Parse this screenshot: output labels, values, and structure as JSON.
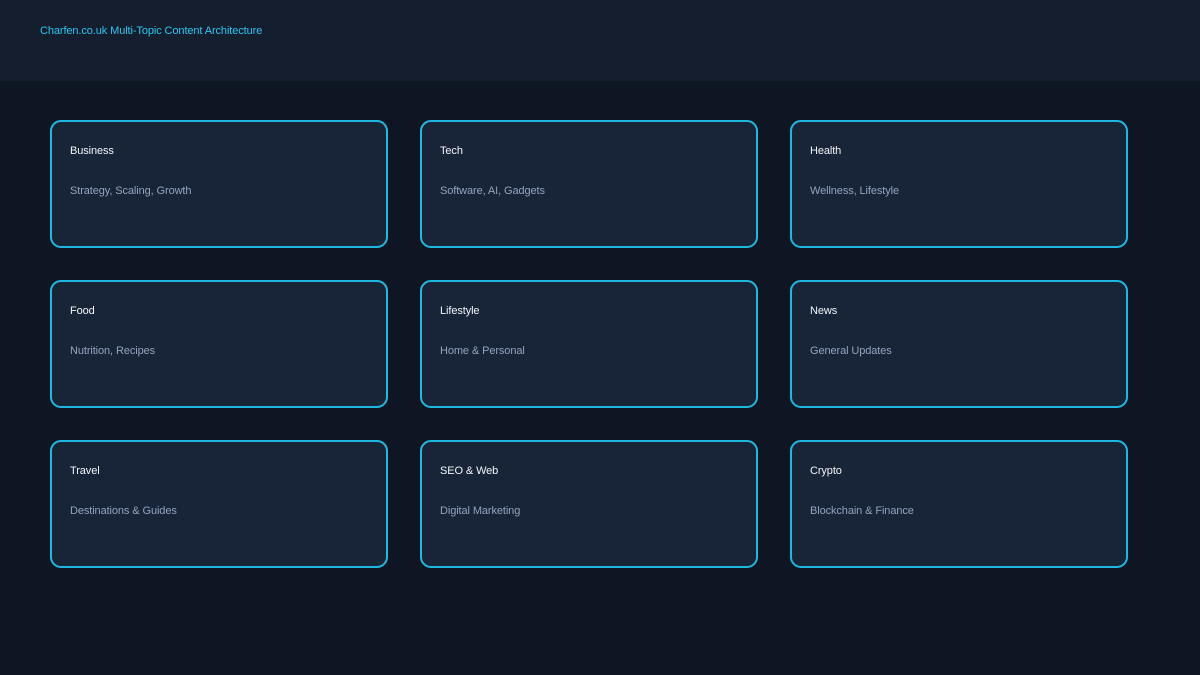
{
  "header": {
    "title": "Charfen.co.uk Multi-Topic Content Architecture"
  },
  "cards": [
    {
      "title": "Business",
      "subtitle": "Strategy, Scaling, Growth"
    },
    {
      "title": "Tech",
      "subtitle": "Software, AI, Gadgets"
    },
    {
      "title": "Health",
      "subtitle": "Wellness, Lifestyle"
    },
    {
      "title": "Food",
      "subtitle": "Nutrition, Recipes"
    },
    {
      "title": "Lifestyle",
      "subtitle": "Home & Personal"
    },
    {
      "title": "News",
      "subtitle": "General Updates"
    },
    {
      "title": "Travel",
      "subtitle": "Destinations & Guides"
    },
    {
      "title": "SEO & Web",
      "subtitle": "Digital Marketing"
    },
    {
      "title": "Crypto",
      "subtitle": "Blockchain & Finance"
    }
  ],
  "colors": {
    "background": "#0f1623",
    "header_background": "#141e2f",
    "card_background": "#182437",
    "card_border": "#1fb8e0",
    "accent": "#2ec6ef",
    "card_title": "#f2f5f9",
    "card_subtitle": "#93a4c1"
  }
}
